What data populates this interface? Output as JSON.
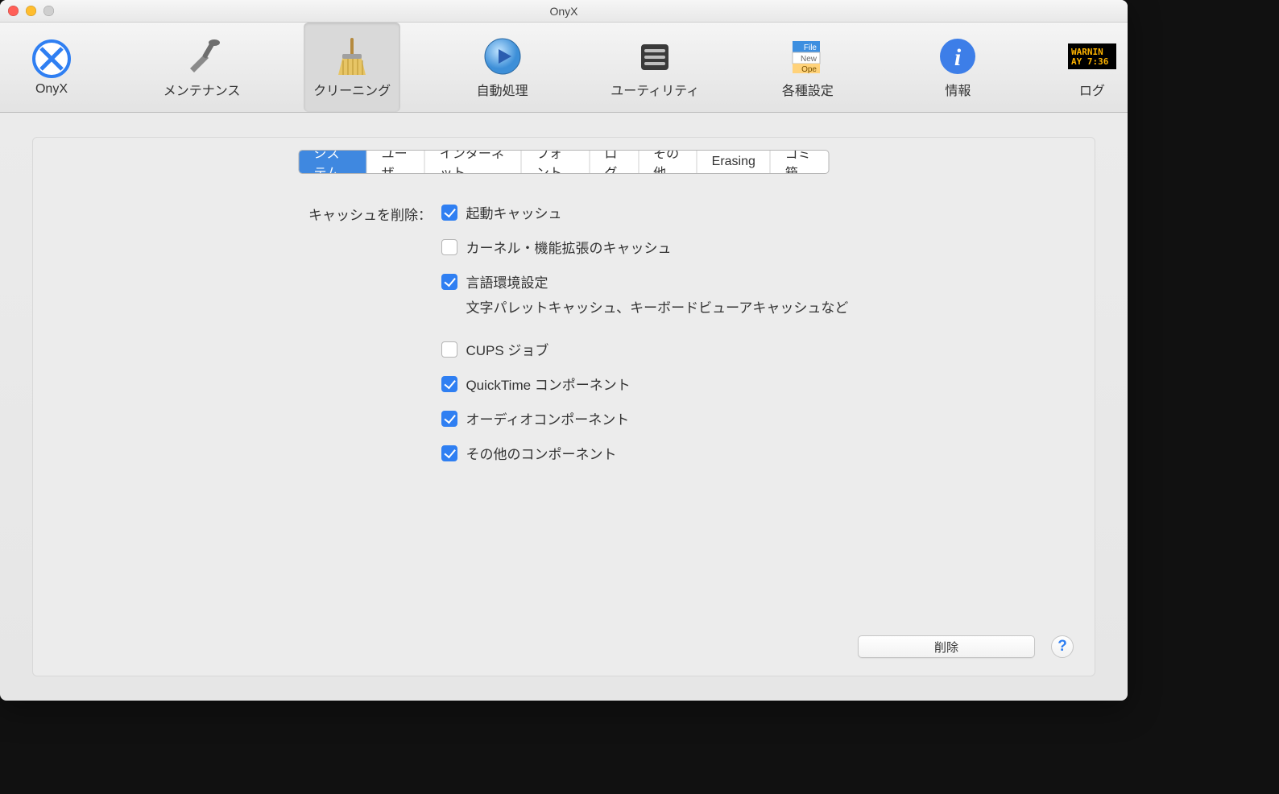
{
  "window": {
    "title": "OnyX"
  },
  "toolbar": {
    "items": [
      {
        "label": "OnyX"
      },
      {
        "label": "メンテナンス"
      },
      {
        "label": "クリーニング"
      },
      {
        "label": "自動処理"
      },
      {
        "label": "ユーティリティ"
      },
      {
        "label": "各種設定"
      },
      {
        "label": "情報"
      },
      {
        "label": "ログ"
      }
    ],
    "selected_index": 2
  },
  "tabs": {
    "items": [
      "システム",
      "ユーザ",
      "インターネット",
      "フォント",
      "ログ",
      "その他",
      "Erasing",
      "ゴミ箱"
    ],
    "active_index": 0
  },
  "section_label": "キャッシュを削除：",
  "options": [
    {
      "label": "起動キャッシュ",
      "checked": true
    },
    {
      "label": "カーネル・機能拡張のキャッシュ",
      "checked": false
    },
    {
      "label": "言語環境設定",
      "checked": true,
      "sub": "文字パレットキャッシュ、キーボードビューアキャッシュなど"
    },
    {
      "label": "CUPS ジョブ",
      "checked": false
    },
    {
      "label": "QuickTime コンポーネント",
      "checked": true
    },
    {
      "label": "オーディオコンポーネント",
      "checked": true
    },
    {
      "label": "その他のコンポーネント",
      "checked": true
    }
  ],
  "buttons": {
    "execute": "削除",
    "help": "?"
  },
  "log_icon_text": {
    "l1": "WARNIN",
    "l2": "AY 7:36"
  }
}
